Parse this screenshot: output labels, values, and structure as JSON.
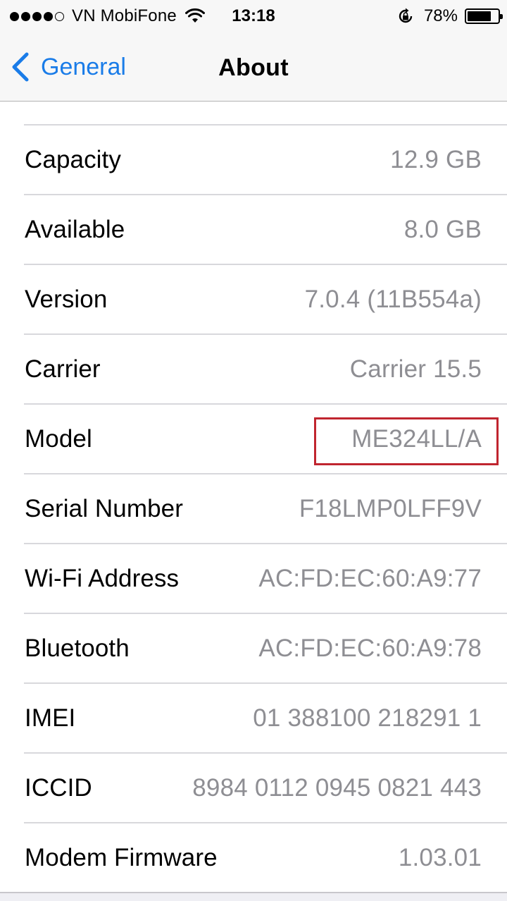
{
  "status_bar": {
    "carrier": "VN MobiFone",
    "signal_bars_filled": 4,
    "signal_bars_total": 5,
    "time": "13:18",
    "battery_percent": "78%",
    "battery_level": 0.78,
    "icons": [
      "wifi-icon",
      "rotation-lock-icon",
      "battery-icon"
    ]
  },
  "nav": {
    "back_label": "General",
    "title": "About",
    "accent_color": "#1a7ce8"
  },
  "highlight_color": "#c0252f",
  "rows": [
    {
      "label": "Capacity",
      "value": "12.9 GB"
    },
    {
      "label": "Available",
      "value": "8.0 GB"
    },
    {
      "label": "Version",
      "value": "7.0.4 (11B554a)"
    },
    {
      "label": "Carrier",
      "value": "Carrier 15.5"
    },
    {
      "label": "Model",
      "value": "ME324LL/A",
      "highlighted": true
    },
    {
      "label": "Serial Number",
      "value": "F18LMP0LFF9V"
    },
    {
      "label": "Wi-Fi Address",
      "value": "AC:FD:EC:60:A9:77"
    },
    {
      "label": "Bluetooth",
      "value": "AC:FD:EC:60:A9:78"
    },
    {
      "label": "IMEI",
      "value": "01 388100 218291 1"
    },
    {
      "label": "ICCID",
      "value": "8984 0112 0945 0821 443"
    },
    {
      "label": "Modem Firmware",
      "value": "1.03.01"
    }
  ]
}
